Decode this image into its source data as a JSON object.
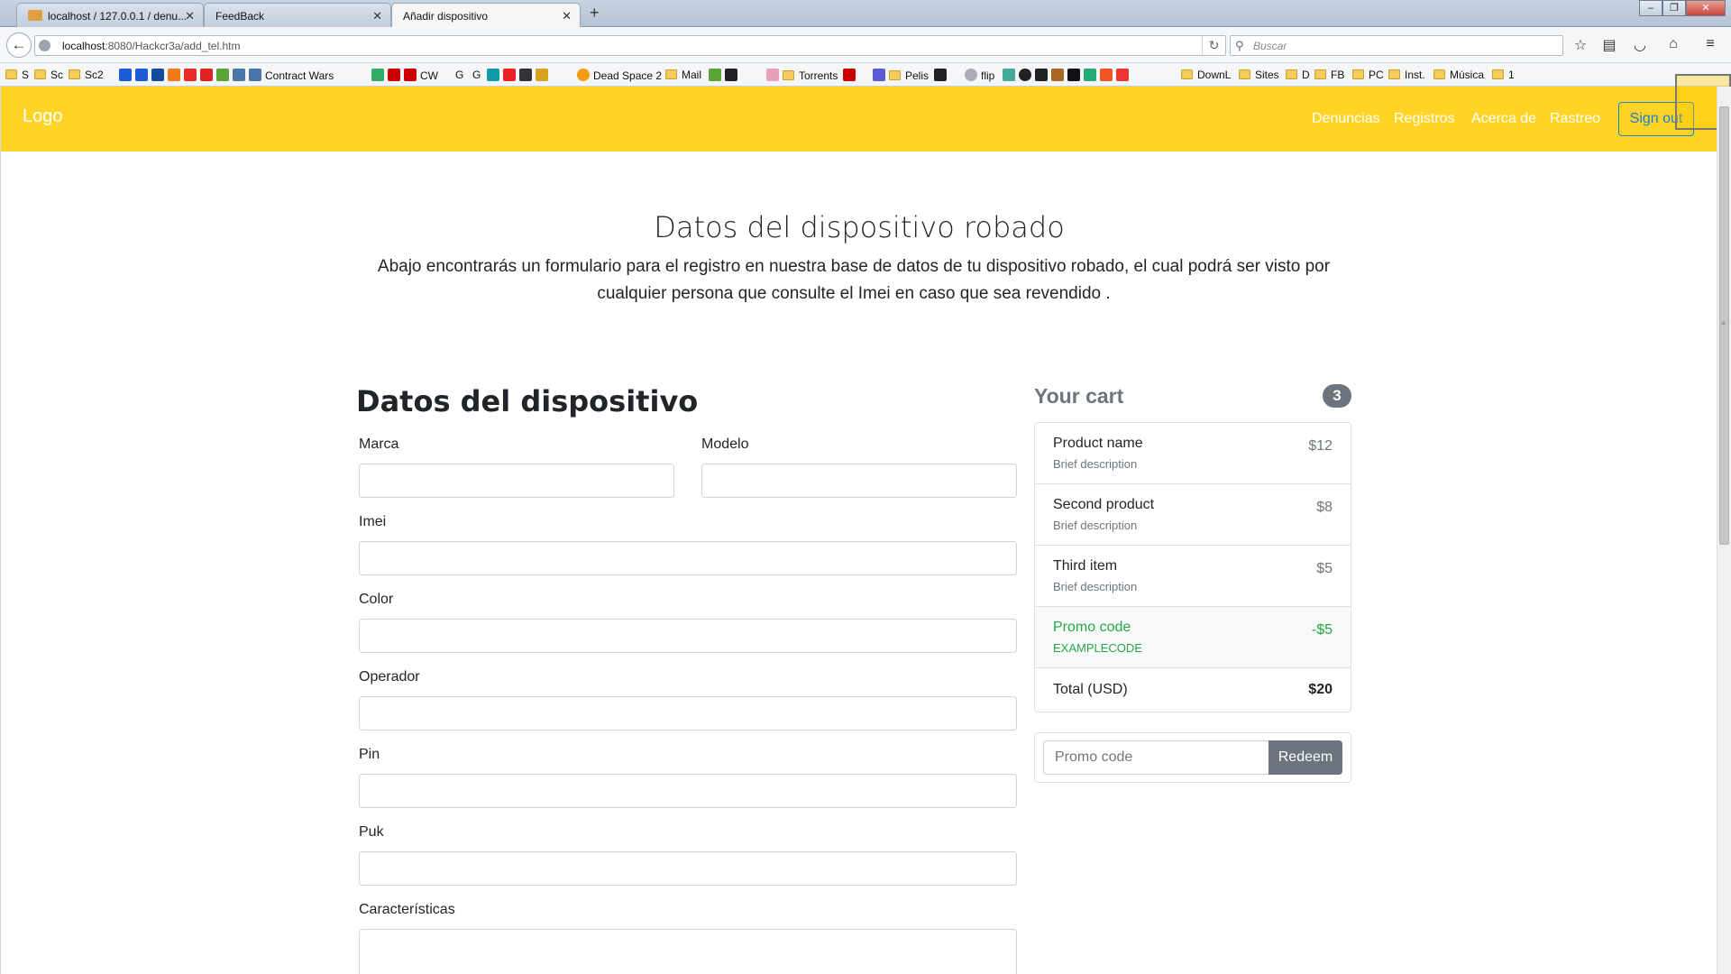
{
  "browser": {
    "tabs": [
      {
        "title": "localhost / 127.0.0.1 / denu...",
        "active": false
      },
      {
        "title": "FeedBack",
        "active": false
      },
      {
        "title": "Añadir dispositivo",
        "active": true
      }
    ],
    "new_tab": "+",
    "url_host": "localhost",
    "url_path": ":8080/Hackcr3a/add_tel.htm",
    "search_placeholder": "Buscar",
    "bookmarks": [
      "S",
      "Sc",
      "Sc2",
      "Contract Wars",
      "CW",
      "G",
      "G",
      "Dead Space 2",
      "Mail",
      "Torrents",
      "Pelis",
      "flip",
      "DownL",
      "Sites",
      "D",
      "FB",
      "PC",
      "Inst.",
      "Música",
      "1"
    ]
  },
  "site": {
    "logo": "Logo",
    "nav": [
      "Denuncias",
      "Registros",
      "Acerca de",
      "Rastreo"
    ],
    "signout": "Sign out",
    "accent": "#ffd426"
  },
  "hero": {
    "title": "Datos del dispositivo robado",
    "lead_line1": "Abajo encontrarás un formulario para el registro en nuestra base de datos de tu dispositivo robado, el cual podrá ser visto por",
    "lead_line2": "cualquier persona que consulte el Imei en caso que sea revendido ."
  },
  "form": {
    "title": "Datos del dispositivo",
    "fields": {
      "marca": "Marca",
      "modelo": "Modelo",
      "imei": "Imei",
      "color": "Color",
      "operador": "Operador",
      "pin": "Pin",
      "puk": "Puk",
      "caracteristicas": "Características"
    }
  },
  "cart": {
    "title": "Your cart",
    "count": "3",
    "items": [
      {
        "name": "Product name",
        "desc": "Brief description",
        "price": "$12"
      },
      {
        "name": "Second product",
        "desc": "Brief description",
        "price": "$8"
      },
      {
        "name": "Third item",
        "desc": "Brief description",
        "price": "$5"
      }
    ],
    "promo": {
      "name": "Promo code",
      "code": "EXAMPLECODE",
      "amount": "-$5"
    },
    "total_label": "Total (USD)",
    "total_value": "$20",
    "promo_placeholder": "Promo code",
    "redeem": "Redeem"
  }
}
